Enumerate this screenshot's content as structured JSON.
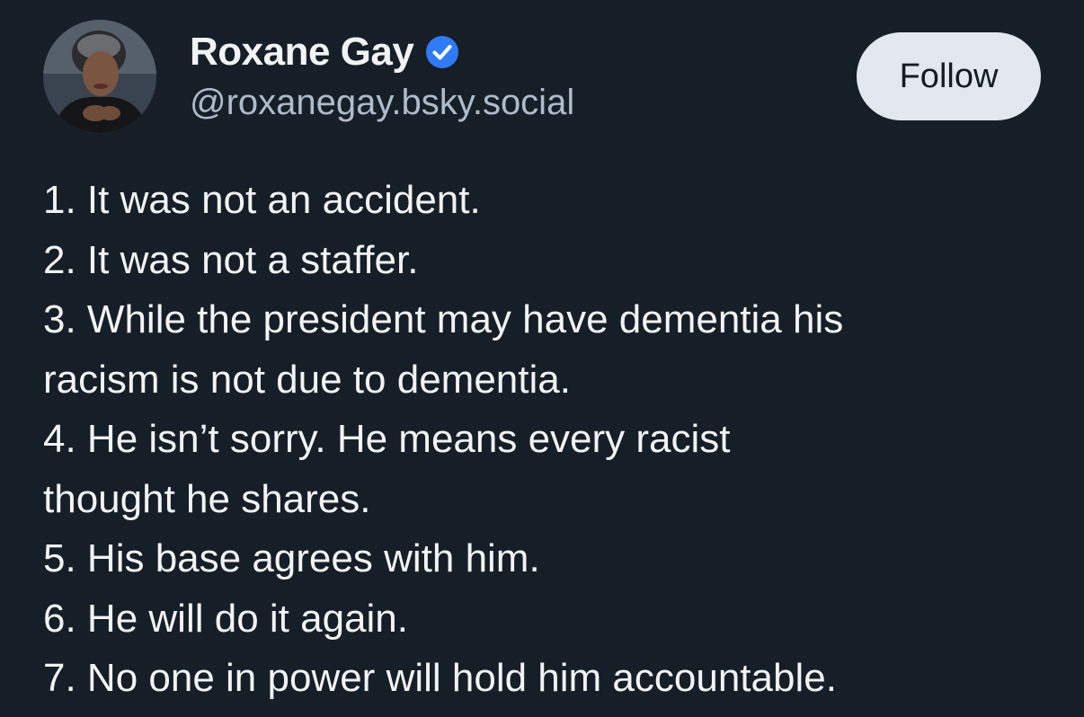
{
  "author": {
    "display_name": "Roxane Gay",
    "handle": "@roxanegay.bsky.social",
    "verified": true
  },
  "actions": {
    "follow_label": "Follow"
  },
  "post": {
    "lines": [
      "1. It was not an accident.",
      "2. It was not a staffer.",
      "3. While the president may have dementia his",
      "racism is not due to dementia.",
      "4. He isn’t sorry. He means every racist",
      "thought he shares.",
      "5. His base agrees with him.",
      "6. He will do it again.",
      "7. No one in power will hold him accountable."
    ]
  },
  "colors": {
    "background": "#161e27",
    "text": "#f1f3f5",
    "handle": "#aebbc9",
    "verified_badge": "#2f7bf5",
    "follow_bg": "#e3e7f0"
  },
  "icons": {
    "verified": "verified-check-icon",
    "avatar": "profile-photo"
  }
}
